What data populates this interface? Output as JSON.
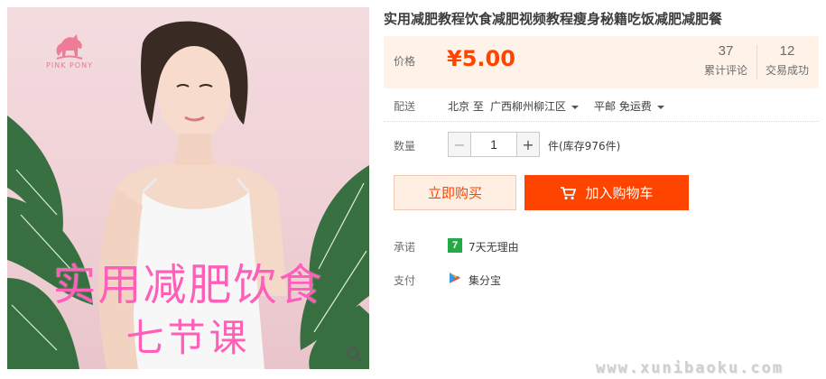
{
  "product": {
    "title": "实用减肥教程饮食减肥视频教程瘦身秘籍吃饭减肥减肥餐",
    "image": {
      "brand": "PINK PONY",
      "promo_line1": "实用减肥饮食",
      "promo_line2": "七节课",
      "zoom_icon": "magnifier-icon"
    }
  },
  "price": {
    "label": "价格",
    "value": "¥5.00",
    "color": "#ff4400"
  },
  "stats": [
    {
      "value": "37",
      "label": "累计评论"
    },
    {
      "value": "12",
      "label": "交易成功"
    }
  ],
  "delivery": {
    "label": "配送",
    "from": "北京 至",
    "to": "广西柳州柳江区",
    "shipping": "平邮 免运费"
  },
  "quantity": {
    "label": "数量",
    "minus": "−",
    "value": "1",
    "plus": "+",
    "stock": "件(库存976件)"
  },
  "actions": {
    "buy_now": "立即购买",
    "add_to_cart": "加入购物车",
    "cart_icon": "cart-icon"
  },
  "promise": {
    "label": "承诺",
    "icon_text": "7",
    "text": "7天无理由"
  },
  "payment": {
    "label": "支付",
    "icon": "jifenbao-icon",
    "text": "集分宝"
  },
  "watermark": "www.xunibaoku.com",
  "colors": {
    "accent": "#ff4400",
    "price_bg": "#fff2e8",
    "promo_text": "#ff5fb8",
    "promise_green": "#23a946"
  }
}
